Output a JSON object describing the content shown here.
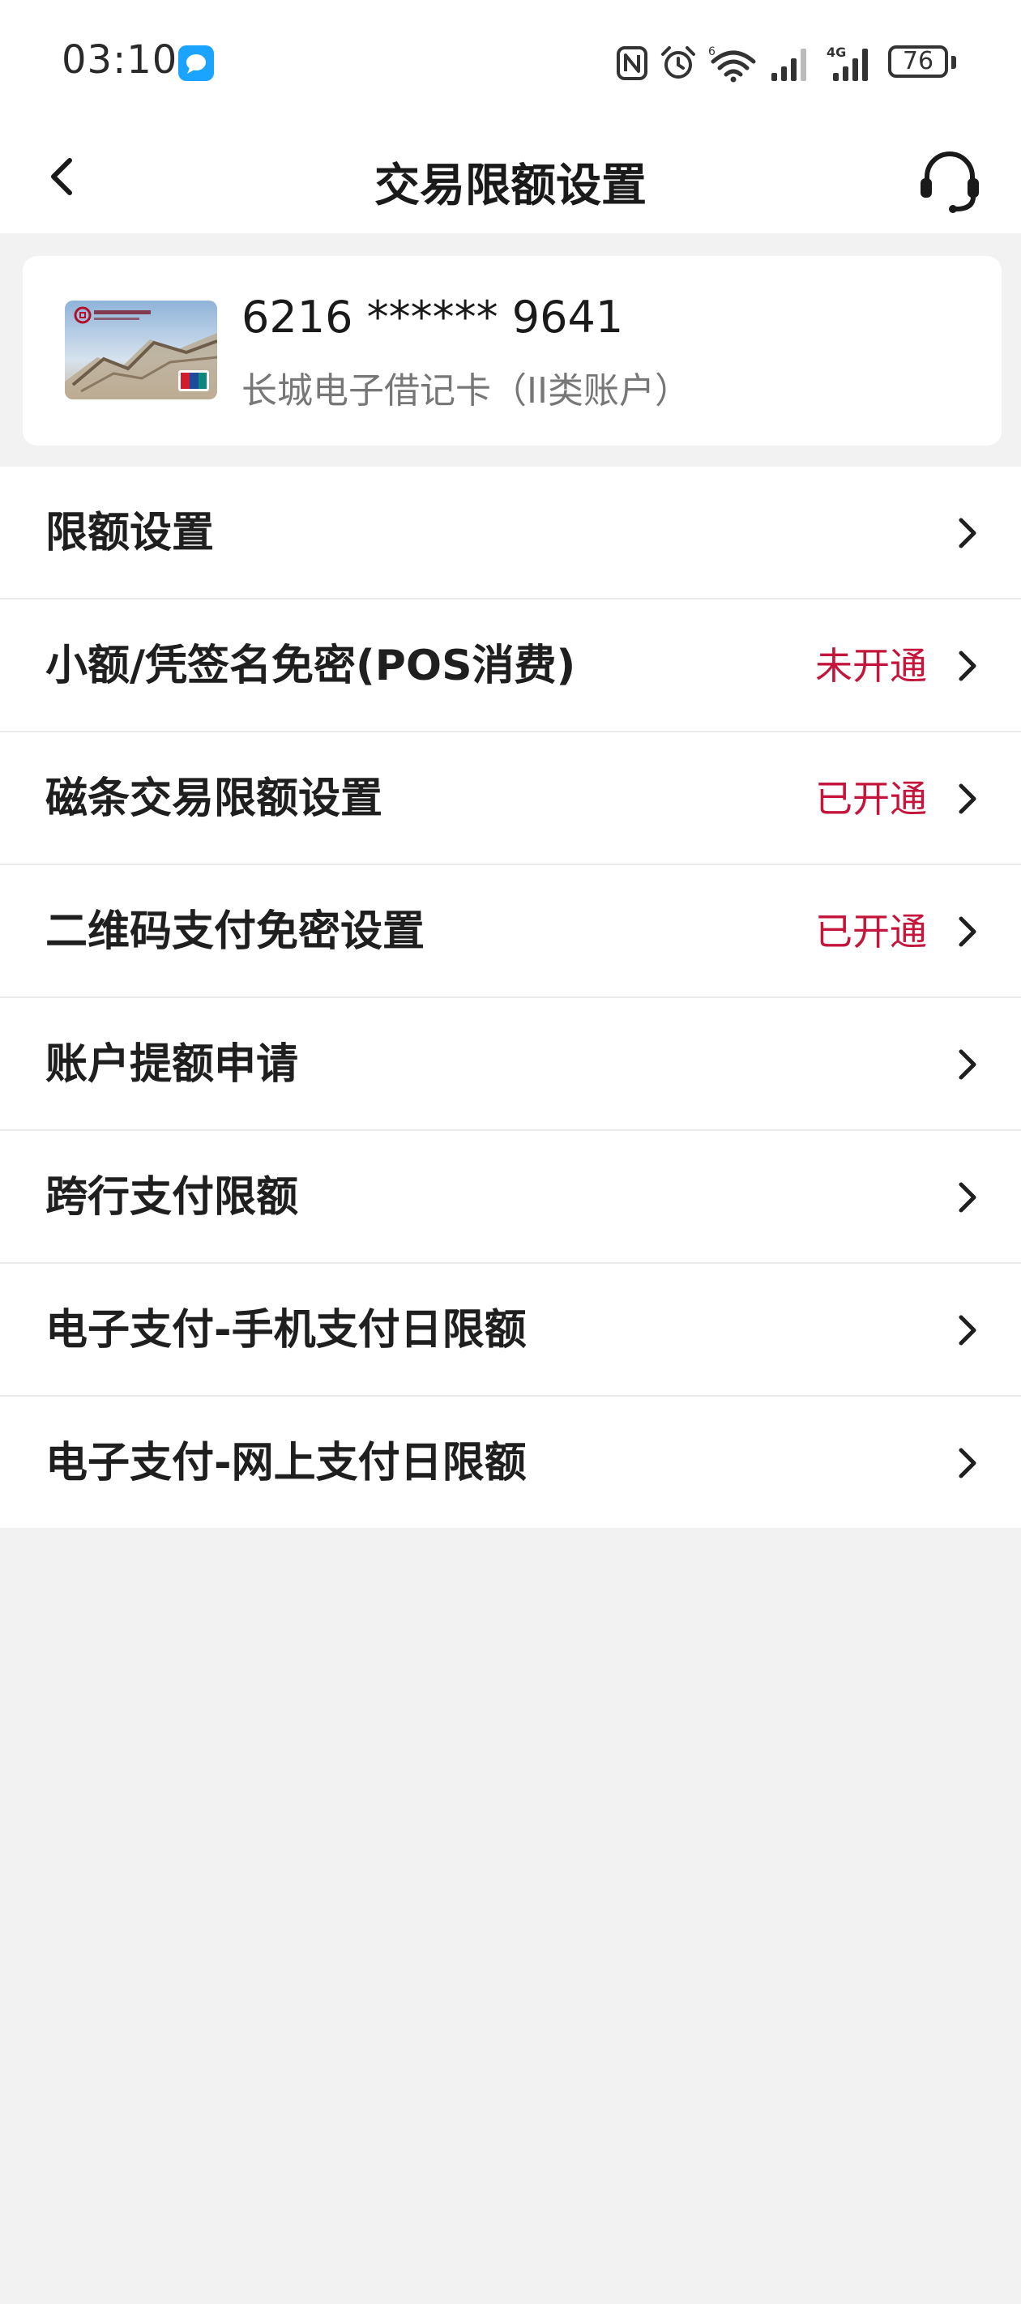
{
  "status_bar": {
    "time": "03:10",
    "battery": "76"
  },
  "header": {
    "title": "交易限额设置"
  },
  "card": {
    "number": "6216 ****** 9641",
    "name": "长城电子借记卡（II类账户）"
  },
  "menu": {
    "items": [
      {
        "label": "限额设置",
        "status": ""
      },
      {
        "label": "小额/凭签名免密(POS消费)",
        "status": "未开通"
      },
      {
        "label": "磁条交易限额设置",
        "status": "已开通"
      },
      {
        "label": "二维码支付免密设置",
        "status": "已开通"
      },
      {
        "label": "账户提额申请",
        "status": ""
      },
      {
        "label": "跨行支付限额",
        "status": ""
      },
      {
        "label": "电子支付-手机支付日限额",
        "status": ""
      },
      {
        "label": "电子支付-网上支付日限额",
        "status": ""
      }
    ]
  },
  "colors": {
    "accent_red": "#c4163c",
    "background": "#f2f2f2"
  },
  "icons": [
    "chat-icon",
    "nfc-icon",
    "alarm-icon",
    "wifi-icon",
    "signal-icon",
    "battery-icon",
    "back-icon",
    "headset-icon",
    "chevron-right-icon"
  ]
}
